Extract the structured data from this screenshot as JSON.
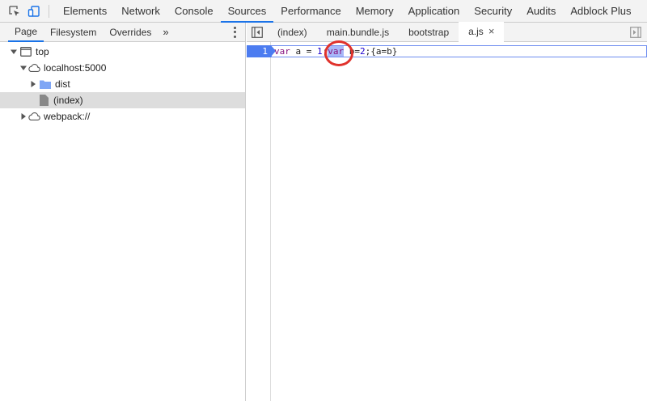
{
  "devtools": {
    "tabs": [
      "Elements",
      "Network",
      "Console",
      "Sources",
      "Performance",
      "Memory",
      "Application",
      "Security",
      "Audits",
      "Adblock Plus"
    ],
    "active_tab": "Sources",
    "icons": [
      "inspect-element-icon",
      "device-toolbar-icon"
    ]
  },
  "navigator": {
    "tabs": [
      "Page",
      "Filesystem",
      "Overrides"
    ],
    "active_tab": "Page",
    "more": "»",
    "tree": {
      "top": "top",
      "host": "localhost:5000",
      "folder": "dist",
      "file": "(index)",
      "webpack": "webpack://"
    }
  },
  "editor": {
    "tabs": [
      "(index)",
      "main.bundle.js",
      "bootstrap",
      "a.js"
    ],
    "active_tab": "a.js",
    "close_glyph": "×",
    "line_number": "1",
    "code": {
      "t1": "var",
      "t2": " a = ",
      "t3": "1",
      "t4": ";",
      "t5": "var",
      "t6": " b=",
      "t7": "2",
      "t8": ";{a=b}"
    }
  },
  "colors": {
    "accent": "#1a73e8",
    "annotation": "#e0322c",
    "line_highlight": "#4c7cf0"
  }
}
